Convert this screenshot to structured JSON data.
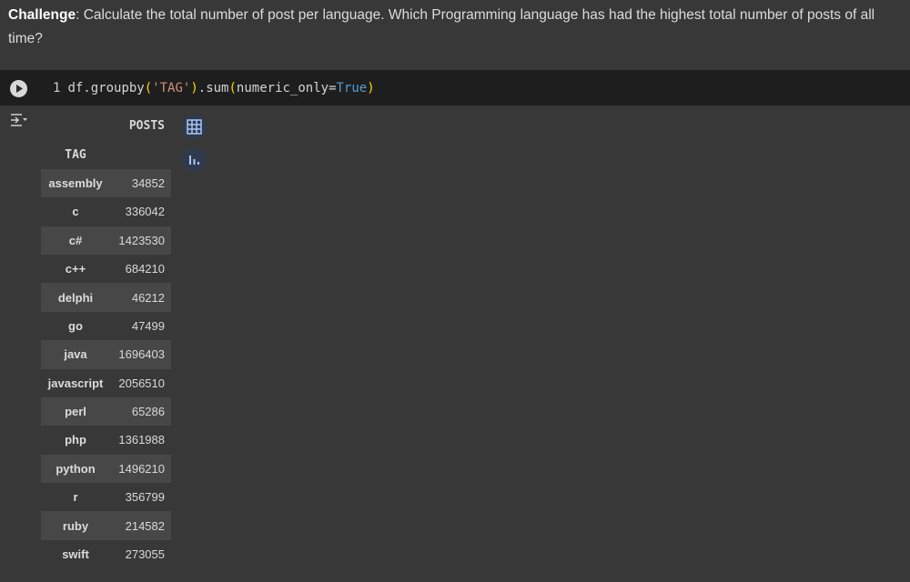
{
  "markdown": {
    "bold_label": "Challenge",
    "text": ": Calculate the total number of post per language. Which Programming language has had the highest total number of posts of all time?"
  },
  "code": {
    "line_number": "1",
    "pre": "df.groupby",
    "open_paren": "(",
    "string_arg": "'TAG'",
    "close_paren": ")",
    "method": ".sum",
    "open_paren2": "(",
    "kwarg": "numeric_only=",
    "kw_value": "True",
    "close_paren2": ")"
  },
  "table": {
    "column_header": "POSTS",
    "index_name": "TAG",
    "rows": [
      {
        "tag": "assembly",
        "posts": "34852"
      },
      {
        "tag": "c",
        "posts": "336042"
      },
      {
        "tag": "c#",
        "posts": "1423530"
      },
      {
        "tag": "c++",
        "posts": "684210"
      },
      {
        "tag": "delphi",
        "posts": "46212"
      },
      {
        "tag": "go",
        "posts": "47499"
      },
      {
        "tag": "java",
        "posts": "1696403"
      },
      {
        "tag": "javascript",
        "posts": "2056510"
      },
      {
        "tag": "perl",
        "posts": "65286"
      },
      {
        "tag": "php",
        "posts": "1361988"
      },
      {
        "tag": "python",
        "posts": "1496210"
      },
      {
        "tag": "r",
        "posts": "356799"
      },
      {
        "tag": "ruby",
        "posts": "214582"
      },
      {
        "tag": "swift",
        "posts": "273055"
      }
    ]
  },
  "icons": {
    "run": "play-icon",
    "output_toggle": "output-toggle-icon",
    "table_view": "table-grid-icon",
    "chart_suggest": "bar-chart-icon"
  }
}
